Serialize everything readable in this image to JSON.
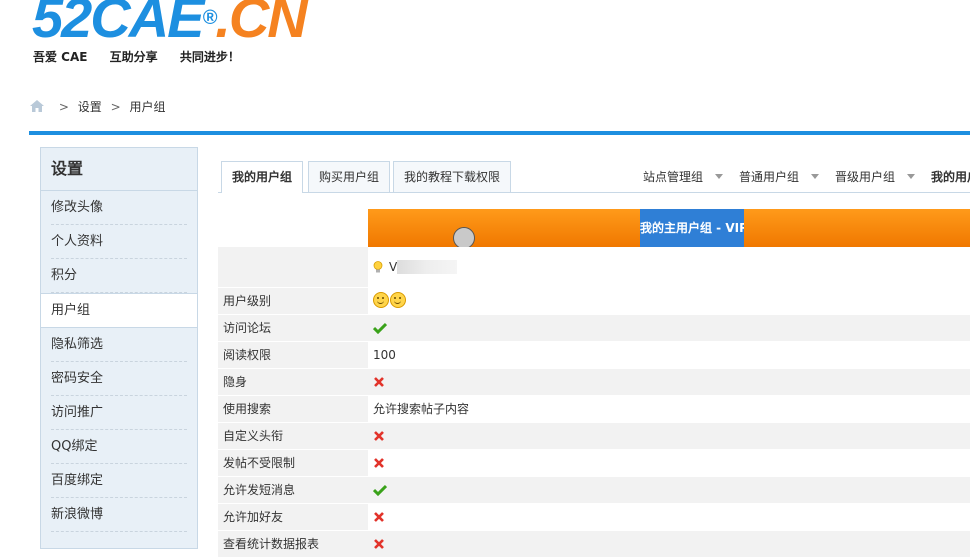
{
  "logo": {
    "main": "52CAE",
    "reg": "®",
    "suffix": ".CN"
  },
  "slogans": [
    "吾爱 CAE",
    "互助分享",
    "共同进步！"
  ],
  "breadcrumb": {
    "sep1": ">",
    "item1": "设置",
    "sep2": ">",
    "item2": "用户组"
  },
  "nav": {
    "title": "设置",
    "items": [
      "修改头像",
      "个人资料",
      "积分",
      "用户组",
      "隐私筛选",
      "密码安全",
      "访问推广",
      "QQ绑定",
      "百度绑定",
      "新浪微博"
    ]
  },
  "tabs": [
    "我的用户组",
    "购买用户组",
    "我的教程下载权限"
  ],
  "groups": [
    "站点管理组",
    "普通用户组",
    "晋级用户组",
    "我的用户"
  ],
  "bar": {
    "label": "我的主用户组 - VIP"
  },
  "table": {
    "rows": [
      {
        "key": "用户级别",
        "value": ""
      },
      {
        "key": "访问论坛",
        "value": ""
      },
      {
        "key": "阅读权限",
        "value": "100"
      },
      {
        "key": "隐身",
        "value": ""
      },
      {
        "key": "使用搜索",
        "value": "允许搜索帖子内容"
      },
      {
        "key": "自定义头衔",
        "value": ""
      },
      {
        "key": "发帖不受限制",
        "value": ""
      },
      {
        "key": "允许发短消息",
        "value": ""
      },
      {
        "key": "允许加好友",
        "value": ""
      },
      {
        "key": "查看统计数据报表",
        "value": ""
      }
    ],
    "vip_level_text": "V"
  },
  "colors": {
    "accent": "#1d8fe0",
    "orange": "#f58220",
    "check": "#3aa21a",
    "cross": "#e2332a"
  }
}
